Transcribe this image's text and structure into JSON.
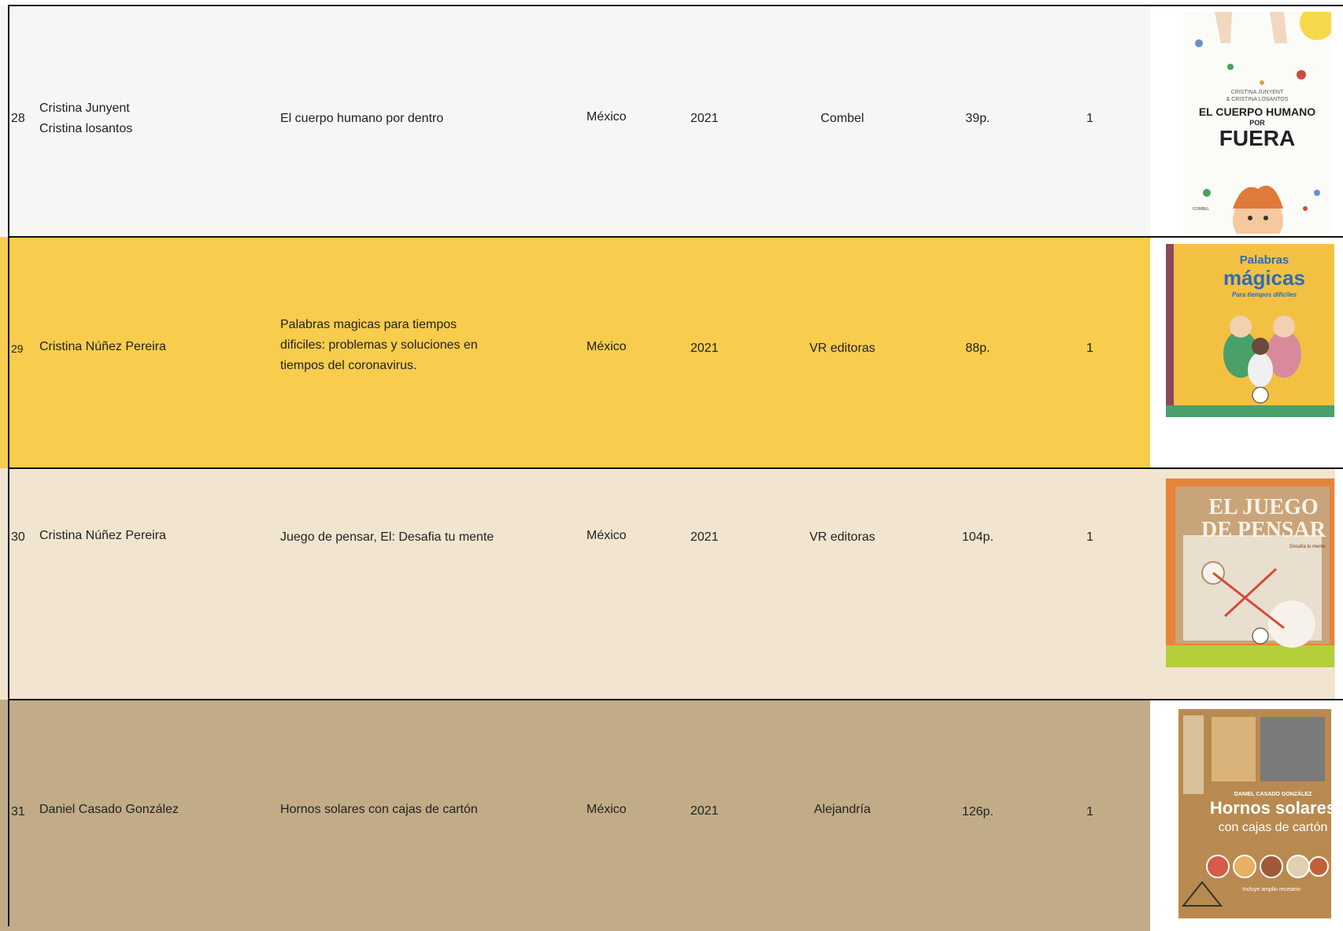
{
  "rows": [
    {
      "num": "28",
      "author_lines": [
        "Cristina Junyent",
        "Cristina losantos"
      ],
      "title_lines": [
        "El cuerpo humano por dentro"
      ],
      "country": "México",
      "year": "2021",
      "publisher": "Combel",
      "pages": "39p.",
      "copies": "1",
      "band_color": "#f6f6f4",
      "cover": {
        "lines": [
          "CRISTINA JUNYENT",
          "& CRISTINA LOSANTOS",
          "EL CUERPO HUMANO",
          "POR",
          "FUERA",
          "COMBEL"
        ]
      }
    },
    {
      "num": "29",
      "author_lines": [
        "Cristina Núñez Pereira"
      ],
      "title_lines": [
        "Palabras magicas para tiempos",
        "dificiles: problemas y soluciones en",
        "tiempos del coronavirus."
      ],
      "country": "México",
      "year": "2021",
      "publisher": "VR editoras",
      "pages": "88p.",
      "copies": "1",
      "band_color": "#f8cc4c",
      "cover": {
        "lines": [
          "Palabras",
          "mágicas",
          "Para tiempos difíciles"
        ]
      }
    },
    {
      "num": "30",
      "author_lines": [
        "Cristina Núñez Pereira"
      ],
      "title_lines": [
        "Juego de pensar, El: Desafia tu mente"
      ],
      "country": "México",
      "year": "2021",
      "publisher": "VR editoras",
      "pages": "104p.",
      "copies": "1",
      "band_color": "#f1e5cf",
      "cover": {
        "lines": [
          "EL JUEGO",
          "DE PENSAR",
          "Desafía tu mente"
        ]
      }
    },
    {
      "num": "31",
      "author_lines": [
        "Daniel Casado González"
      ],
      "title_lines": [
        "Hornos solares con cajas de cartón"
      ],
      "country": "México",
      "year": "2021",
      "publisher": "Alejandría",
      "pages": "126p.",
      "copies": "1",
      "band_color": "#c1ac87",
      "cover": {
        "lines": [
          "DANIEL CASADO GONZÁLEZ",
          "Hornos solares",
          "con cajas de cartón",
          "Incluye amplio recetario"
        ]
      }
    }
  ]
}
